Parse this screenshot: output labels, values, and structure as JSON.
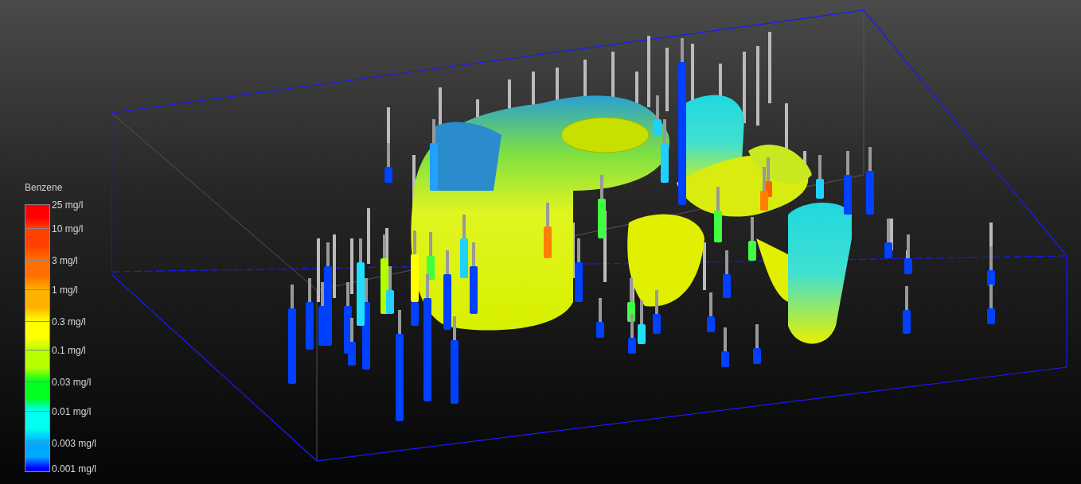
{
  "legend": {
    "title": "Benzene",
    "stops": [
      {
        "label": "25 mg/l",
        "color": "#ff0000"
      },
      {
        "label": "10 mg/l",
        "color": "#ff4000"
      },
      {
        "label": "3 mg/l",
        "color": "#ff7000"
      },
      {
        "label": "1 mg/l",
        "color": "#ffb000"
      },
      {
        "label": "0.3 mg/l",
        "color": "#ffff00"
      },
      {
        "label": "0.1 mg/l",
        "color": "#b8ff00"
      },
      {
        "label": "0.03 mg/l",
        "color": "#00ff20"
      },
      {
        "label": "0.01 mg/l",
        "color": "#00ffee"
      },
      {
        "label": "0.003 mg/l",
        "color": "#00a8ff"
      },
      {
        "label": "0.001 mg/l",
        "color": "#0000ff"
      }
    ]
  }
}
